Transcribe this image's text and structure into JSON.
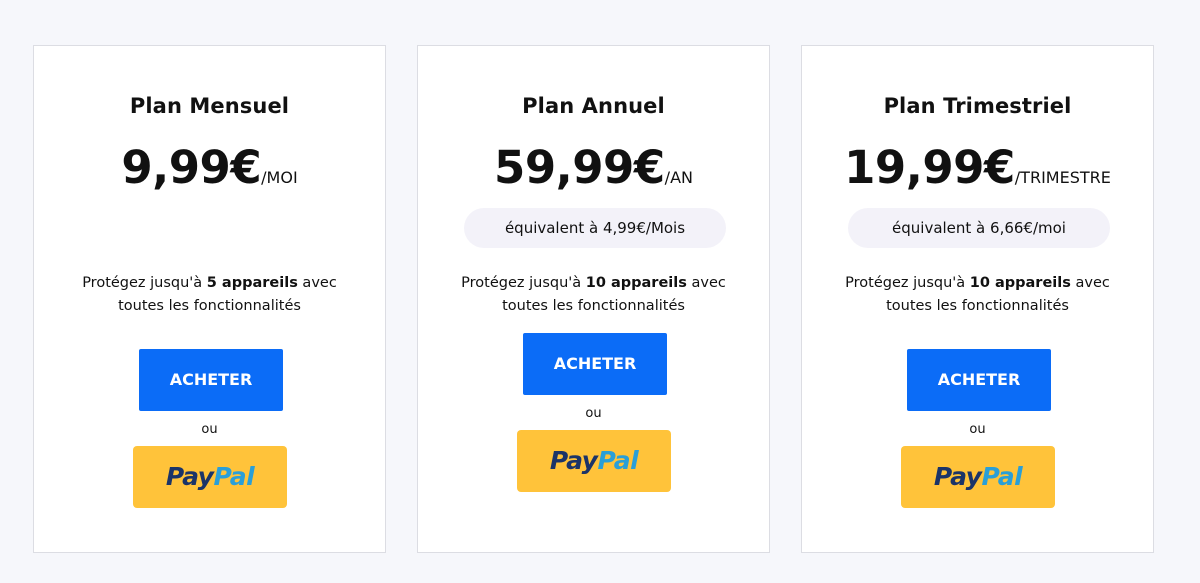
{
  "plans": [
    {
      "title": "Plan Mensuel",
      "price": "9,99€",
      "period": "/MOI",
      "equivalent": "",
      "features_prefix": "Protégez jusqu'à ",
      "features_bold": "5 appareils",
      "features_suffix": " avec",
      "features_line2": "toutes les fonctionnalités",
      "buy_label": "ACHETER",
      "or_label": "ou",
      "paypal_pay": "Pay",
      "paypal_pal": "Pal"
    },
    {
      "title": "Plan Annuel",
      "price": "59,99€",
      "period": "/AN",
      "equivalent": "équivalent à 4,99€/Mois",
      "features_prefix": "Protégez jusqu'à ",
      "features_bold": "10 appareils",
      "features_suffix": " avec",
      "features_line2": "toutes les fonctionnalités",
      "buy_label": "ACHETER",
      "or_label": "ou",
      "paypal_pay": "Pay",
      "paypal_pal": "Pal"
    },
    {
      "title": "Plan Trimestriel",
      "price": "19,99€",
      "period": "/TRIMESTRE",
      "equivalent": "équivalent à 6,66€/moi",
      "features_prefix": "Protégez jusqu'à ",
      "features_bold": "10 appareils",
      "features_suffix": " avec",
      "features_line2": "toutes les fonctionnalités",
      "buy_label": "ACHETER",
      "or_label": "ou",
      "paypal_pay": "Pay",
      "paypal_pal": "Pal"
    }
  ],
  "colors": {
    "page_background": "#f6f7fb",
    "buy_button": "#0b6cf7",
    "paypal_button": "#ffc33a",
    "paypal_dark_blue": "#1b3468",
    "paypal_light_blue": "#2a9fd8",
    "equivalent_pill": "#f3f2f9"
  }
}
